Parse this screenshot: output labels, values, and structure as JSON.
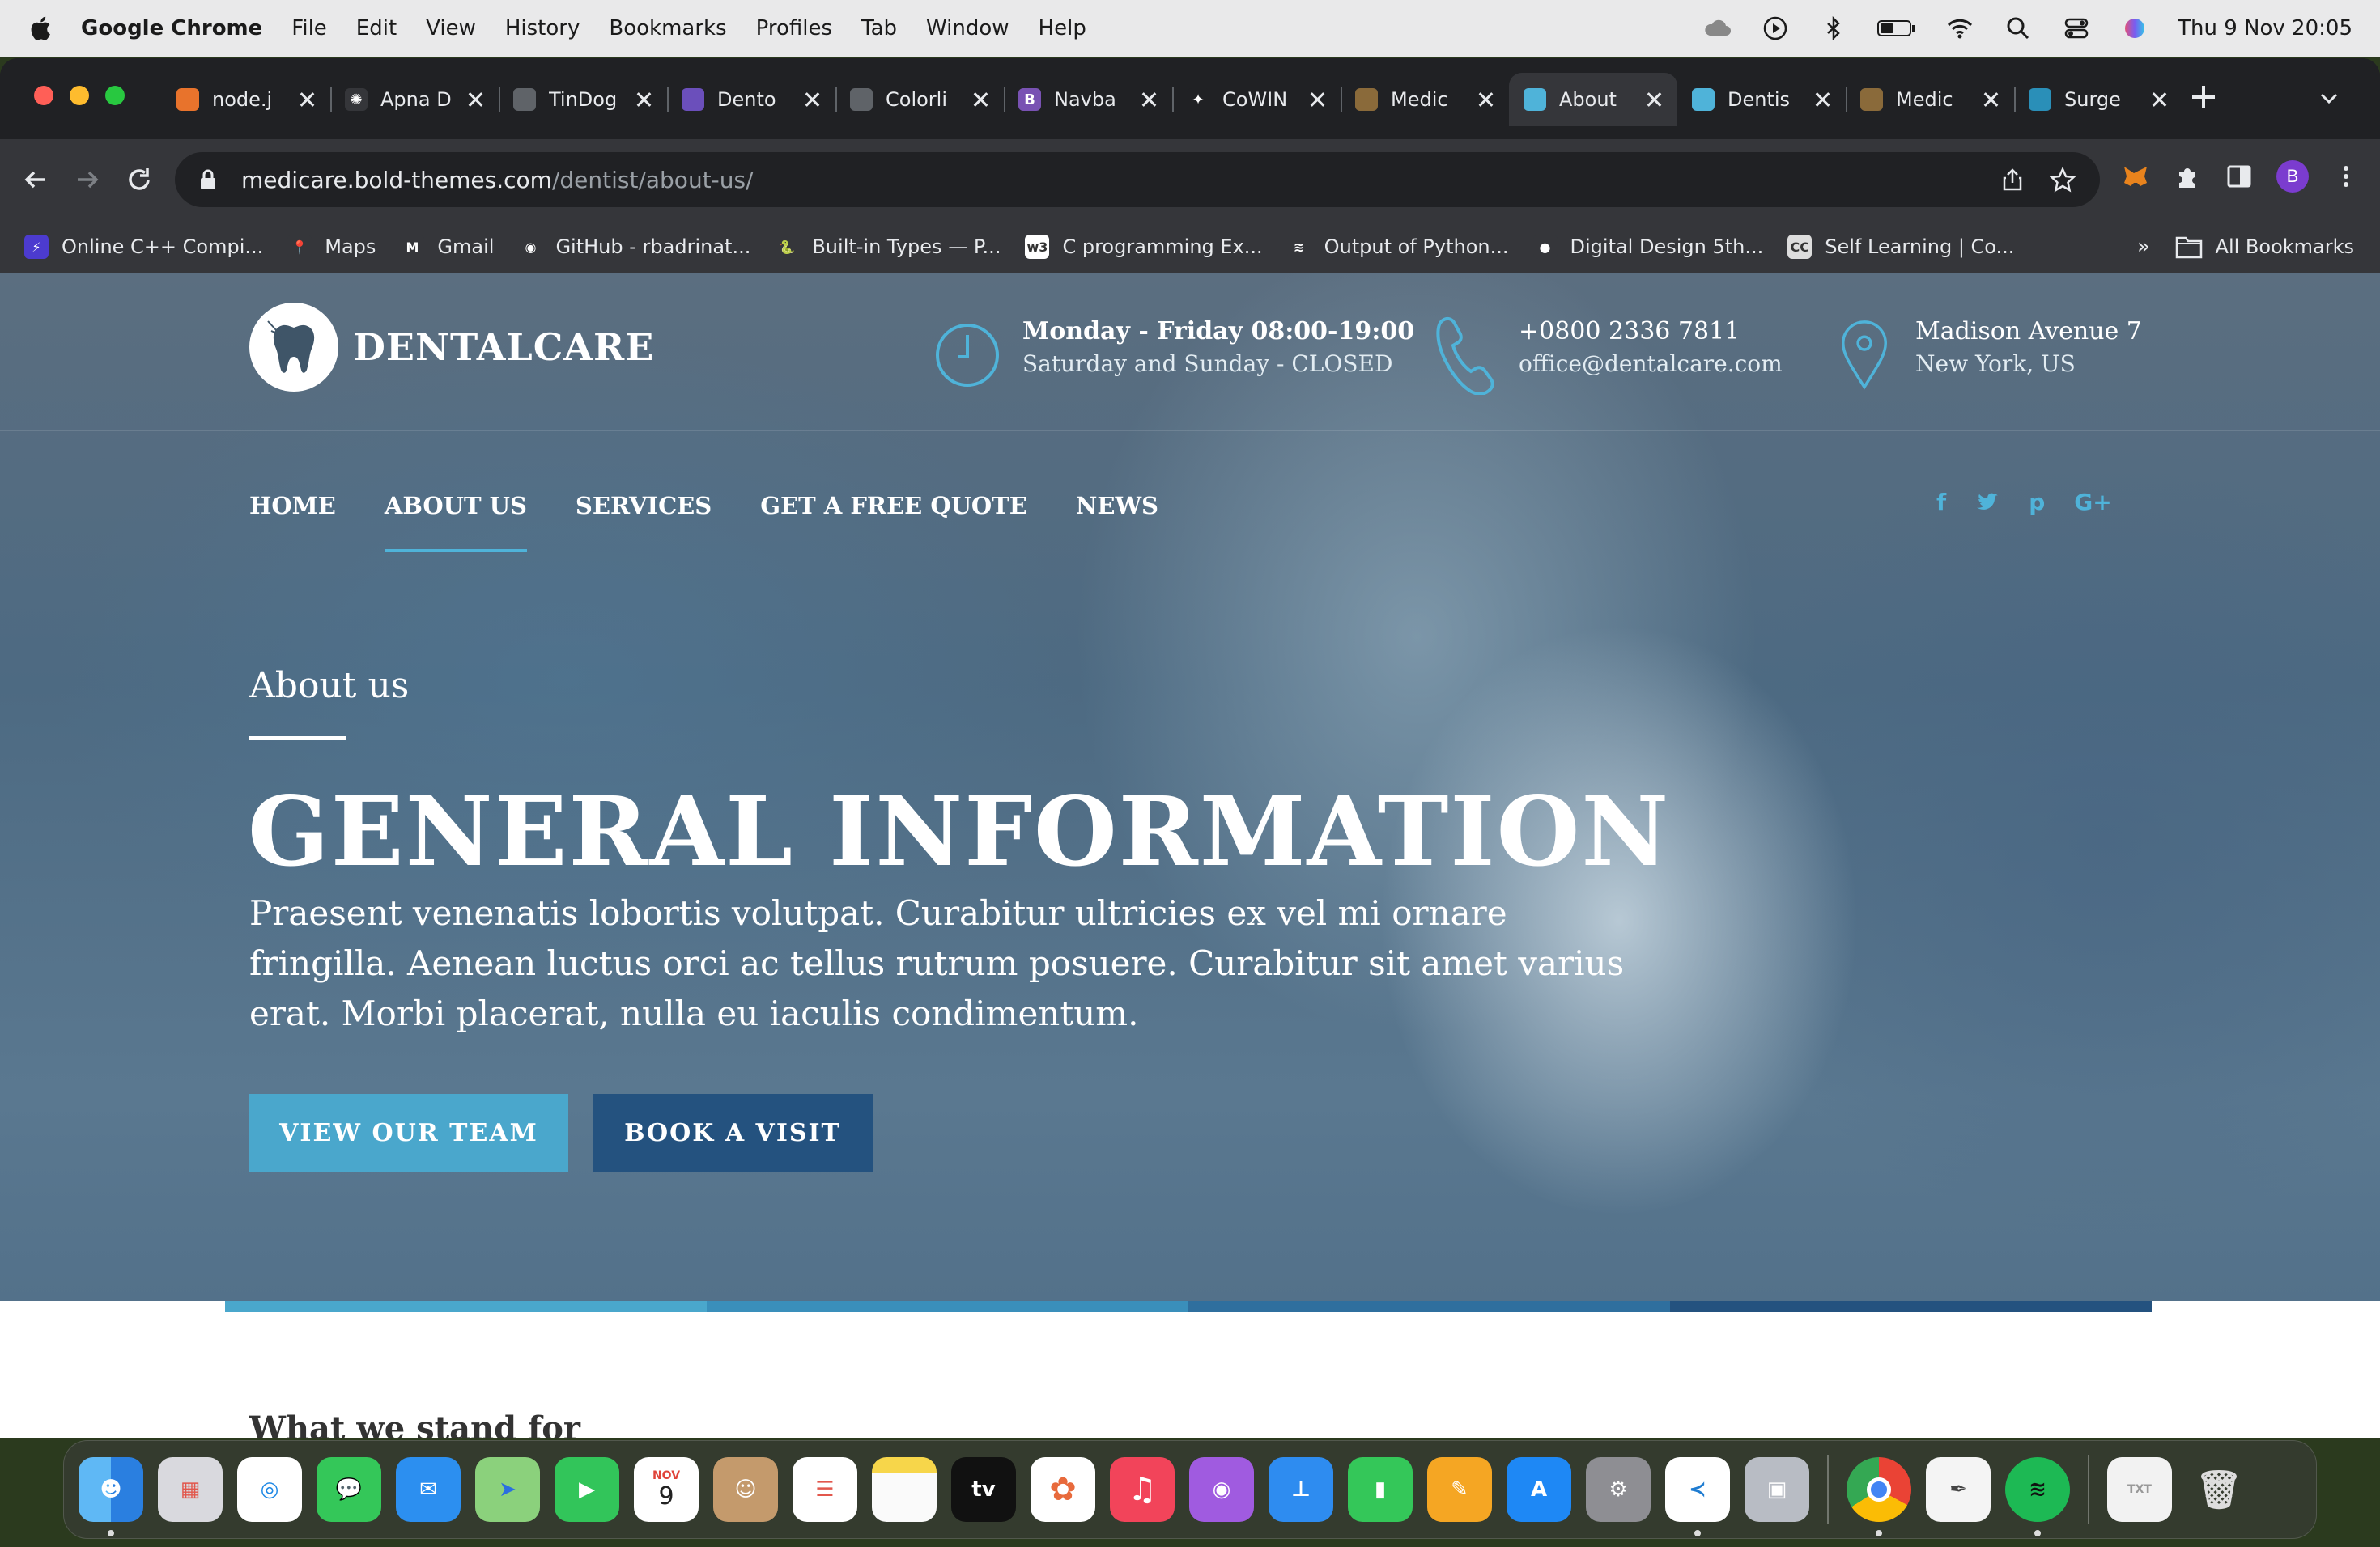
{
  "menubar": {
    "app_name": "Google Chrome",
    "menus": [
      "File",
      "Edit",
      "View",
      "History",
      "Bookmarks",
      "Profiles",
      "Tab",
      "Window",
      "Help"
    ],
    "datetime": "Thu 9 Nov  20:05"
  },
  "tabs": [
    {
      "title": "node.j",
      "favicon_color": "#e8732c",
      "favicon_glyph": ""
    },
    {
      "title": "Apna D",
      "favicon_color": "#35363a",
      "favicon_glyph": "✺"
    },
    {
      "title": "TinDog",
      "favicon_color": "#5f6368",
      "favicon_glyph": ""
    },
    {
      "title": "Dento",
      "favicon_color": "#6b4fbb",
      "favicon_glyph": ""
    },
    {
      "title": "Colorli",
      "favicon_color": "#5f6368",
      "favicon_glyph": ""
    },
    {
      "title": "Navba",
      "favicon_color": "#7952b3",
      "favicon_glyph": "B"
    },
    {
      "title": "CoWIN",
      "favicon_color": "#202124",
      "favicon_glyph": "✦"
    },
    {
      "title": "Medic",
      "favicon_color": "#8a6a3a",
      "favicon_glyph": ""
    },
    {
      "title": "About",
      "favicon_color": "#4fb3d9",
      "favicon_glyph": "",
      "active": true
    },
    {
      "title": "Dentis",
      "favicon_color": "#4fb3d9",
      "favicon_glyph": ""
    },
    {
      "title": "Medic",
      "favicon_color": "#8a6a3a",
      "favicon_glyph": ""
    },
    {
      "title": "Surge",
      "favicon_color": "#2a8fb8",
      "favicon_glyph": ""
    }
  ],
  "address_bar": {
    "host": "medicare.bold-themes.com",
    "path": "/dentist/about-us/"
  },
  "profile_initial": "B",
  "bookmarks": [
    {
      "label": "Online C++ Compi...",
      "color": "#4c3bcf",
      "glyph": "⚡"
    },
    {
      "label": "Maps",
      "color": "#35363a",
      "glyph": "📍"
    },
    {
      "label": "Gmail",
      "color": "#35363a",
      "glyph": "M"
    },
    {
      "label": "GitHub - rbadrinat...",
      "color": "#35363a",
      "glyph": "◉"
    },
    {
      "label": "Built-in Types — P...",
      "color": "#35363a",
      "glyph": "🐍"
    },
    {
      "label": "C programming Ex...",
      "color": "#ffffff",
      "glyph": "w3"
    },
    {
      "label": "Output of Python...",
      "color": "#35363a",
      "glyph": "≋"
    },
    {
      "label": "Digital Design 5th...",
      "color": "#35363a",
      "glyph": "●"
    },
    {
      "label": "Self Learning | Co...",
      "color": "#dddddd",
      "glyph": "CC"
    }
  ],
  "bookmarks_more": "»",
  "bookmarks_all": "All Bookmarks",
  "site": {
    "logo_text": "DENTALCARE",
    "hours": {
      "line1": "Monday - Friday 08:00-19:00",
      "line2": "Saturday and Sunday - CLOSED"
    },
    "contact": {
      "line1": "+0800 2336 7811",
      "line2": "office@dentalcare.com"
    },
    "address": {
      "line1": "Madison Avenue 7",
      "line2": "New York, US"
    },
    "nav": [
      "HOME",
      "ABOUT US",
      "SERVICES",
      "GET A FREE QUOTE",
      "NEWS"
    ],
    "nav_active": "ABOUT US",
    "social": [
      "f",
      "t",
      "p",
      "G+"
    ],
    "eyebrow": "About us",
    "headline": "GENERAL INFORMATION",
    "lead": "Praesent venenatis lobortis volutpat. Curabitur ultricies ex vel mi ornare fringilla. Aenean luctus orci ac tellus rutrum posuere. Curabitur sit amet varius erat. Morbi placerat, nulla eu iaculis condimentum.",
    "btn_team": "VIEW OUR TEAM",
    "btn_book": "BOOK A VISIT",
    "section_title": "What we stand for",
    "accent_color": "#4fb3d9",
    "dark_blue": "#24527f",
    "progress_colors": [
      "#4aa7cc",
      "#3a8fbb",
      "#2f6f9e",
      "#24527f"
    ]
  },
  "dock": {
    "calendar_month": "NOV",
    "calendar_day": "9",
    "tv_label": "tv"
  }
}
